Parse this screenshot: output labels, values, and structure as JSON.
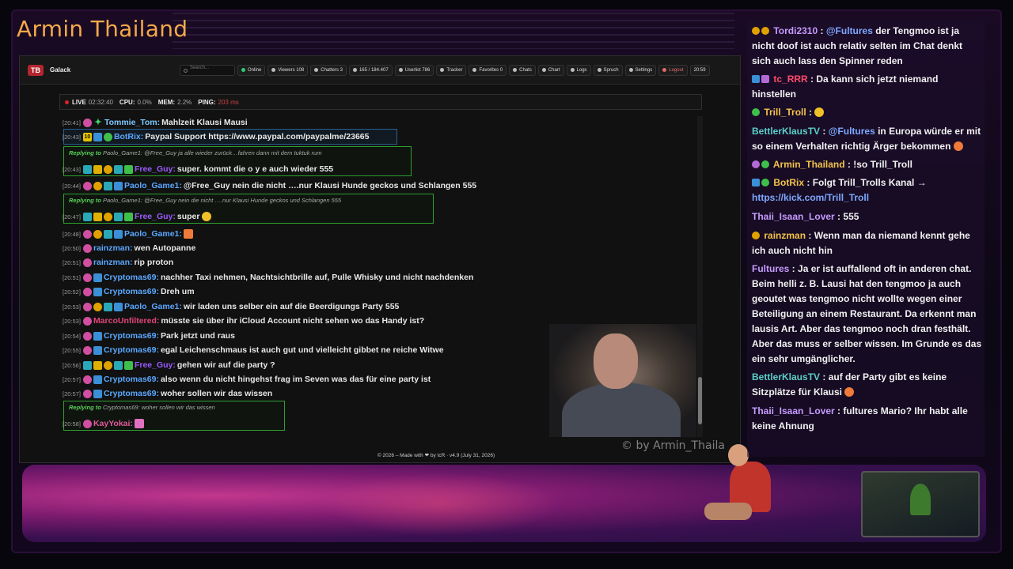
{
  "overlay": {
    "channel_title": "Armin Thailand",
    "watermark": "© by Armin_Thaila"
  },
  "app": {
    "logo": "TB",
    "name": "Galack",
    "search_placeholder": "Search...",
    "toolbar": [
      {
        "id": "online",
        "label": "Online"
      },
      {
        "id": "viewers",
        "label": "Viewers  108"
      },
      {
        "id": "chatters",
        "label": "Chatters  3"
      },
      {
        "id": "messages",
        "label": "165 / 184.407"
      },
      {
        "id": "userlist",
        "label": "Userlist 786"
      },
      {
        "id": "tracker",
        "label": "Tracker"
      },
      {
        "id": "favorites",
        "label": "Favorites 0"
      },
      {
        "id": "chats",
        "label": "Chats"
      },
      {
        "id": "chart",
        "label": "Chart"
      },
      {
        "id": "logs",
        "label": "Logs"
      },
      {
        "id": "spruch",
        "label": "Spruch"
      },
      {
        "id": "settings",
        "label": "Settings"
      },
      {
        "id": "logout",
        "label": "Logout"
      }
    ],
    "clock": "20:59",
    "status": {
      "live_label": "LIVE",
      "live_value": "02:32:40",
      "cpu_label": "CPU:",
      "cpu_value": "0.0%",
      "mem_label": "MEM:",
      "mem_value": "2.2%",
      "ping_label": "PING:",
      "ping_value": "203 ms"
    },
    "footer": "© 2026 – Made with ❤ by tcR · v4.9 (July 31, 2026)"
  },
  "chat": {
    "messages": [
      {
        "time": "[20:41]",
        "user": "Tommie_Tom:",
        "color": "#7ec8ff",
        "text": "Mahlzeit Klausi Mausi"
      },
      {
        "time": "[20:43]",
        "user": "BotRix:",
        "color": "#5aa8ff",
        "text": "Paypal Support https://www.paypal.com/paypalme/23665"
      },
      {
        "time": "[20:43]",
        "user": "Free_Guy:",
        "color": "#9b59ff",
        "text": "super. kommt die o y e auch wieder 555"
      },
      {
        "time": "[20:44]",
        "user": "Paolo_Game1:",
        "color": "#5aa8ff",
        "text": "@Free_Guy nein die nicht ….nur Klausi Hunde geckos und Schlangen 555"
      },
      {
        "time": "[20:47]",
        "user": "Free_Guy:",
        "color": "#9b59ff",
        "text": "super"
      },
      {
        "time": "[20:48]",
        "user": "Paolo_Game1:",
        "color": "#5aa8ff",
        "text": ""
      },
      {
        "time": "[20:50]",
        "user": "rainzman:",
        "color": "#5aa8ff",
        "text": "wen Autopanne"
      },
      {
        "time": "[20:51]",
        "user": "rainzman:",
        "color": "#5aa8ff",
        "text": "rip proton"
      },
      {
        "time": "[20:51]",
        "user": "Cryptomas69:",
        "color": "#5aa8ff",
        "text": "nachher Taxi nehmen, Nachtsichtbrille auf, Pulle Whisky und nicht nachdenken"
      },
      {
        "time": "[20:52]",
        "user": "Cryptomas69:",
        "color": "#5aa8ff",
        "text": "Dreh um"
      },
      {
        "time": "[20:53]",
        "user": "Paolo_Game1:",
        "color": "#5aa8ff",
        "text": "wir laden uns selber ein auf die Beerdigungs Party 555"
      },
      {
        "time": "[20:53]",
        "user": "MarcoUnfiltered:",
        "color": "#e0457a",
        "text": "müsste sie über ihr iCloud Account nicht sehen wo das Handy ist?"
      },
      {
        "time": "[20:54]",
        "user": "Cryptomas69:",
        "color": "#5aa8ff",
        "text": "Park jetzt und raus"
      },
      {
        "time": "[20:55]",
        "user": "Cryptomas69:",
        "color": "#5aa8ff",
        "text": "egal Leichenschmaus ist auch gut und vielleicht gibbet ne reiche Witwe"
      },
      {
        "time": "[20:56]",
        "user": "Free_Guy:",
        "color": "#9b59ff",
        "text": "gehen wir auf die party ?"
      },
      {
        "time": "[20:57]",
        "user": "Cryptomas69:",
        "color": "#5aa8ff",
        "text": "also wenn du nicht hingehst frag im Seven was das für eine party ist"
      },
      {
        "time": "[20:57]",
        "user": "Cryptomas69:",
        "color": "#5aa8ff",
        "text": "woher sollen wir das wissen"
      },
      {
        "time": "[20:58]",
        "user": "KayYokai:",
        "color": "#e05a9a",
        "text": ""
      }
    ],
    "replies": [
      {
        "label": "Replying to",
        "target": "Paolo_Game1:",
        "text": "@Free_Guy ja alle wieder zurück…fahren dann mit dem tuktuk rum"
      },
      {
        "label": "Replying to",
        "target": "Paolo_Game1:",
        "text": "@Free_Guy nein die nicht ….nur Klausi Hunde geckos und Schlangen 555"
      },
      {
        "label": "Replying to",
        "target": "Cryptomas69:",
        "text": "woher sollen wir das wissen"
      }
    ]
  },
  "sidebar": {
    "messages": [
      {
        "user": "Tordi2310",
        "color": "#c79bff",
        "mention": "@Fultures",
        "text": "der Tengmoo ist ja nicht doof ist auch relativ selten im Chat denkt sich auch lass den Spinner reden"
      },
      {
        "user": "tc_RRR",
        "color": "#ff4a6a",
        "mention": "",
        "text": "Da kann sich jetzt niemand hinstellen"
      },
      {
        "user": "Trill_Troll",
        "color": "#f3c34a",
        "mention": "",
        "text": ""
      },
      {
        "user": "BettlerKlausTV",
        "color": "#5ad0c8",
        "mention": "@Fultures",
        "text": "in Europa würde er mit so einem Verhalten richtig Ärger bekommen"
      },
      {
        "user": "Armin_Thailand",
        "color": "#f3c34a",
        "mention": "",
        "text": "!so Trill_Troll"
      },
      {
        "user": "BotRix",
        "color": "#f3c34a",
        "mention": "",
        "text": "Folgt Trill_Trolls Kanal →",
        "link": "https://kick.com/Trill_Troll"
      },
      {
        "user": "Thaii_Isaan_Lover",
        "color": "#c79bff",
        "mention": "",
        "text": "555"
      },
      {
        "user": "rainzman",
        "color": "#f3c34a",
        "mention": "",
        "text": "Wenn man da niemand kennt gehe ich auch nicht hin"
      },
      {
        "user": "Fultures",
        "color": "#c79bff",
        "mention": "",
        "text": "Ja er ist auffallend oft in anderen chat. Beim helli z. B. Lausi hat den tengmoo ja auch geoutet was tengmoo nicht wollte wegen einer Beteiligung an einem Restaurant. Da erkennt man lausis Art. Aber das tengmoo noch dran festhält. Aber das muss er selber wissen. Im Grunde es das ein sehr umgänglicher."
      },
      {
        "user": "BettlerKlausTV",
        "color": "#5ad0c8",
        "mention": "",
        "text": "auf der Party gibt es keine Sitzplätze für Klausi"
      },
      {
        "user": "Thaii_Isaan_Lover",
        "color": "#c79bff",
        "mention": "",
        "text": "fultures Mario? Ihr habt alle keine Ahnung"
      }
    ]
  }
}
